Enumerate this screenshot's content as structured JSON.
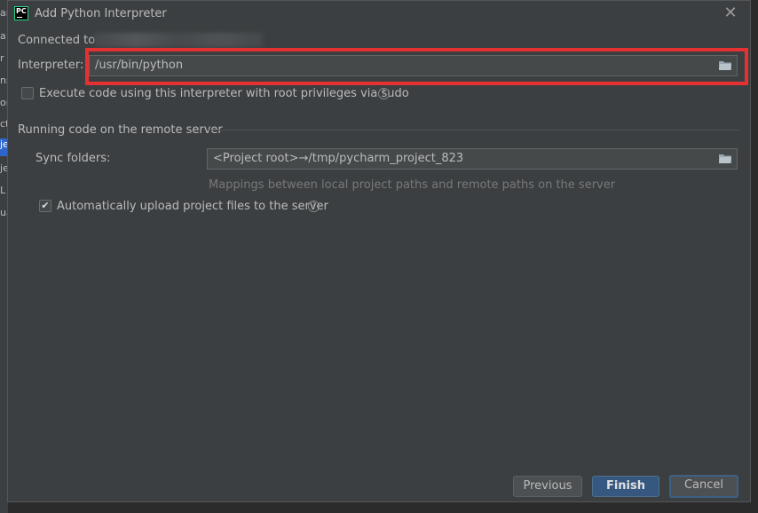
{
  "background": {
    "left_fragments": [
      "ar",
      "a",
      "r",
      "ns",
      "on",
      "ct",
      "je",
      "je",
      "L",
      "ua"
    ]
  },
  "dialog": {
    "title": "Add Python Interpreter",
    "connected_label": "Connected to",
    "interpreter": {
      "label": "Interpreter:",
      "value": "/usr/bin/python"
    },
    "sudo_option": {
      "label": "Execute code using this interpreter with root privileges via sudo",
      "checked": false
    },
    "remote_section": {
      "title": "Running code on the remote server",
      "sync_folders": {
        "label": "Sync folders:",
        "value": "<Project root>→/tmp/pycharm_project_823"
      },
      "hint": "Mappings between local project paths and remote paths on the server",
      "auto_upload": {
        "label": "Automatically upload project files to the server",
        "checked": true
      }
    },
    "buttons": {
      "previous": "Previous",
      "finish": "Finish",
      "cancel": "Cancel"
    },
    "help_glyph": "?",
    "close_glyph": "✕",
    "logo_text": "PC",
    "check_glyph": "✔"
  },
  "colors": {
    "dialog_bg": "#3c3f41",
    "highlight": "#e53131",
    "primary_button": "#365880"
  }
}
